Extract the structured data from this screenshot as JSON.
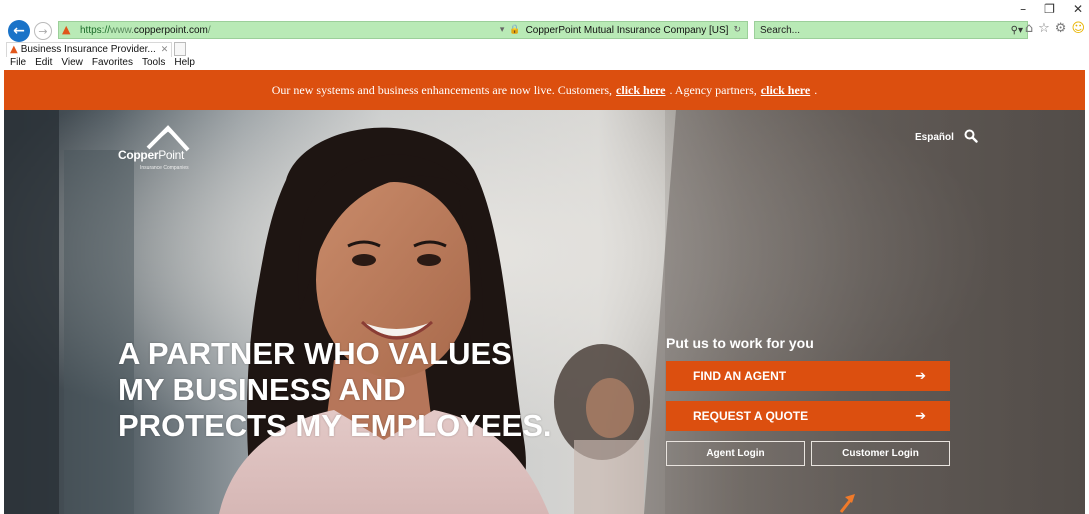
{
  "browser": {
    "window_controls": [
      "–",
      "❐",
      "✕"
    ],
    "url_scheme": "https://",
    "url_www": "www.",
    "url_domain": "copperpoint.com",
    "url_suffix": "/",
    "address_dropdown": "▾",
    "cert_label": "CopperPoint Mutual Insurance Company [US]",
    "lock_glyph": "🔒",
    "refresh_glyph": "↻",
    "search_placeholder": "Search...",
    "search_go": "⚲▾",
    "tab_title": "Business Insurance Provider...",
    "tab_close": "✕",
    "menu": [
      "File",
      "Edit",
      "View",
      "Favorites",
      "Tools",
      "Help"
    ],
    "toolbar_icons": [
      "home-icon",
      "star-icon",
      "gear-icon",
      "smiley-icon"
    ],
    "toolbar_glyphs": [
      "⌂",
      "☆",
      "⚙",
      "☺"
    ]
  },
  "banner": {
    "text_before": "Our new systems and business enhancements are now live. Customers,",
    "customers_link": "click here",
    "text_middle": ". Agency partners,",
    "agency_link": "click here",
    "text_after": "."
  },
  "logo": {
    "word_bold": "Copper",
    "word_light": "Point",
    "tagline": "Insurance Companies"
  },
  "header": {
    "language_link": "Español"
  },
  "hero": {
    "headline_lines": [
      "A PARTNER WHO VALUES",
      "MY BUSINESS AND",
      "PROTECTS MY EMPLOYEES."
    ]
  },
  "cta": {
    "title": "Put us to work for you",
    "find_agent": "FIND AN AGENT",
    "request_quote": "REQUEST A QUOTE",
    "arrow": "➔",
    "agent_login": "Agent Login",
    "customer_login": "Customer Login"
  },
  "colors": {
    "brand_orange": "#dc4f0f",
    "address_bar_green": "#b9eab6"
  }
}
